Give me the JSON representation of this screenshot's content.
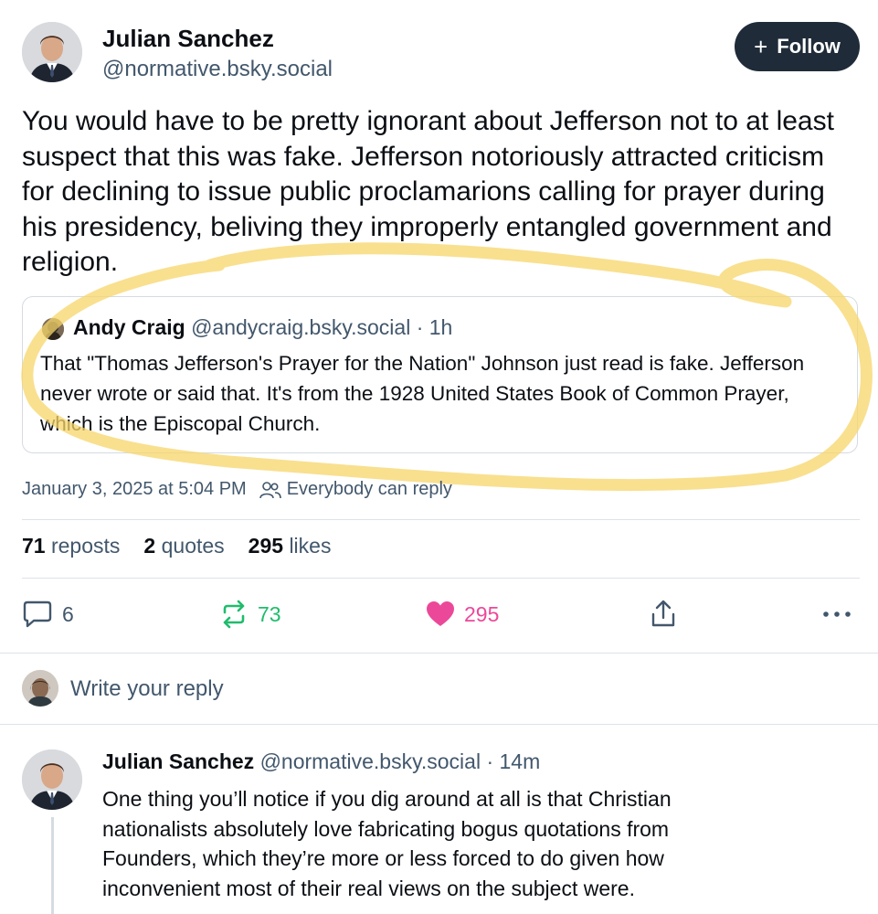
{
  "post": {
    "author_name": "Julian Sanchez",
    "author_handle": "@normative.bsky.social",
    "follow_label": "Follow",
    "text": "You would have to be pretty ignorant about Jefferson not to at least suspect that this was fake. Jefferson notoriously attracted criticism for declining to issue public proclamarions calling for prayer during his presidency, beliving they improperly entangled government and religion.",
    "timestamp": "January 3, 2025 at 5:04 PM",
    "reply_setting": "Everybody can reply"
  },
  "quote": {
    "author_name": "Andy Craig",
    "author_handle": "@andycraig.bsky.social",
    "age": "· 1h",
    "text": "That \"Thomas Jefferson's Prayer for the Nation\" Johnson just read is fake. Jefferson never wrote or said that. It's from the 1928 United States Book of Common Prayer, which is the Episcopal Church."
  },
  "stats": {
    "reposts_count": "71",
    "reposts_label": "reposts",
    "quotes_count": "2",
    "quotes_label": "quotes",
    "likes_count": "295",
    "likes_label": "likes"
  },
  "actions": {
    "reply_count": "6",
    "repost_count": "73",
    "like_count": "295"
  },
  "composer": {
    "placeholder": "Write your reply"
  },
  "reply": {
    "author_name": "Julian Sanchez",
    "author_handle": "@normative.bsky.social",
    "age": "· 14m",
    "text": "One thing you’ll notice if you dig around at all is that Christian nationalists absolutely love fabricating bogus quotations from Founders, which they’re more or less forced to do given how inconvenient most of their real views on the subject were."
  },
  "colors": {
    "accent_repost": "#20bc6c",
    "accent_like": "#ec4899",
    "follow_bg": "#1f2b38",
    "highlight": "#f7d66a",
    "muted_text": "#42576c"
  },
  "icons": [
    "plus-icon",
    "people-icon",
    "reply-bubble-icon",
    "repost-icon",
    "heart-icon",
    "share-icon",
    "more-icon"
  ]
}
